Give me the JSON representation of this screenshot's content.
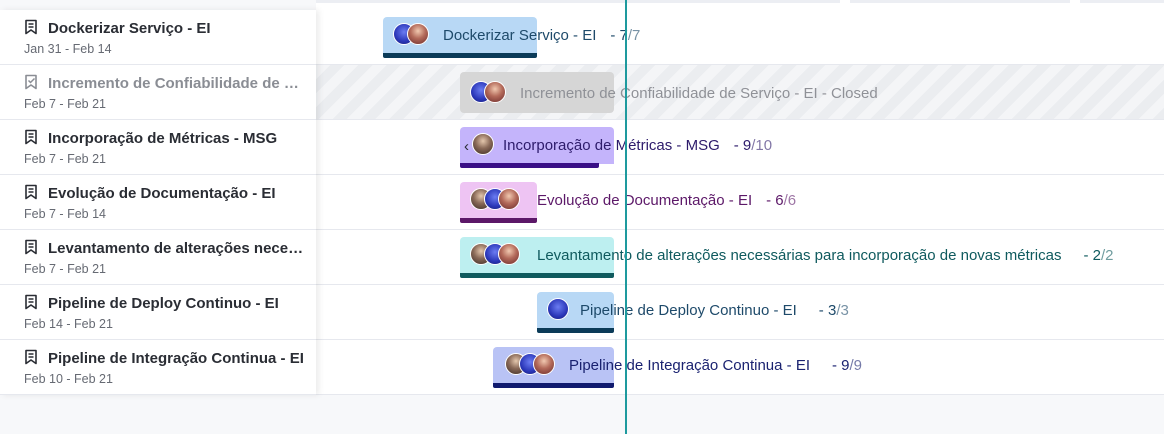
{
  "tasks": [
    {
      "title": "Dockerizar Serviço - EI",
      "dates": "Jan 31 - Feb 14",
      "bar_label": "Dockerizar Serviço - EI",
      "done": "7",
      "total": "/7",
      "colors": {
        "bar": "#b8d8f5",
        "line": "#0b3b58",
        "text": "#1e4a6a"
      }
    },
    {
      "title": "Incremento de Confiabilidade de Serviço - EI - Closed",
      "dates": "Feb 7 - Feb 21",
      "bar_label": "Incremento de Confiabilidade de Serviço - EI - Closed",
      "closed": true,
      "colors": {
        "bar": "#d6d6d6",
        "text": "#8f9197"
      }
    },
    {
      "title": "Incorporação de Métricas - MSG",
      "dates": "Feb 7 - Feb 21",
      "bar_label": "Incorporação de Métricas - MSG",
      "done": "9",
      "total": "/10",
      "colors": {
        "bar": "#c4b4fb",
        "line": "#3a0f86",
        "text": "#2d1b6b"
      }
    },
    {
      "title": "Evolução de Documentação - EI",
      "dates": "Feb 7 - Feb 14",
      "bar_label": "Evolução de Documentação - EI",
      "done": "6",
      "total": "/6",
      "colors": {
        "bar": "#eec4f3",
        "line": "#5c1868",
        "text": "#5c1868"
      }
    },
    {
      "title": "Levantamento de alterações necessárias para incorporação de novas métricas",
      "dates": "Feb 7 - Feb 21",
      "bar_label": "Levantamento de alterações necessárias para incorporação de novas métricas",
      "done": "2",
      "total": "/2",
      "colors": {
        "bar": "#bdeff0",
        "line": "#0f5a5e",
        "text": "#0f5a5e"
      }
    },
    {
      "title": "Pipeline de Deploy Continuo - EI",
      "dates": "Feb 14 - Feb 21",
      "bar_label": "Pipeline de Deploy Continuo - EI",
      "done": "3",
      "total": "/3",
      "colors": {
        "bar": "#b8d8f5",
        "line": "#0b3b58",
        "text": "#1e4a6a"
      }
    },
    {
      "title": "Pipeline de Integração Continua - EI",
      "dates": "Feb 10 - Feb 21",
      "bar_label": "Pipeline de Integração Continua - EI",
      "done": "9",
      "total": "/9",
      "colors": {
        "bar": "#b9c3f5",
        "line": "#101a6e",
        "text": "#1a2270"
      }
    }
  ],
  "icons": {
    "milestone": "bookmark-icon",
    "milestone_closed": "bookmark-check-icon",
    "collapse": "chevron-left-icon"
  },
  "colors": {
    "today_line": "#1e9a9e"
  }
}
